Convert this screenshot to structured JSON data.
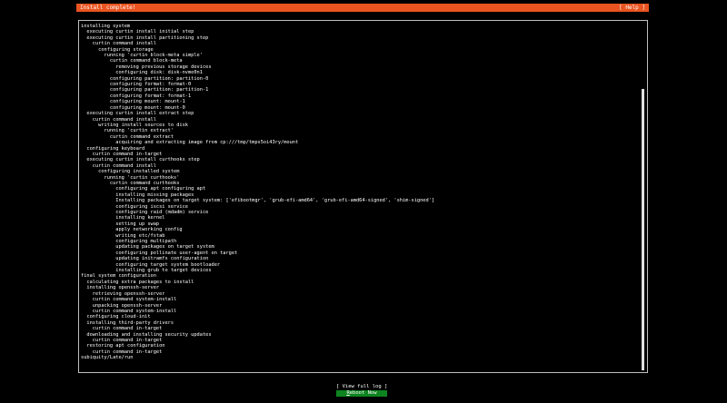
{
  "header": {
    "title": "Install complete!",
    "help": "[ Help ]"
  },
  "log": [
    "installing system",
    "  executing curtin install initial step",
    "  executing curtin install partitioning step",
    "    curtin command install",
    "      configuring storage",
    "        running 'curtin block-meta simple'",
    "          curtin command block-meta",
    "            removing previous storage devices",
    "            configuring disk: disk-nvme0n1",
    "          configuring partition: partition-0",
    "          configuring format: format-0",
    "          configuring partition: partition-1",
    "          configuring format: format-1",
    "          configuring mount: mount-1",
    "          configuring mount: mount-0",
    "  executing curtin install extract step",
    "    curtin command install",
    "      writing install sources to disk",
    "        running 'curtin extract'",
    "          curtin command extract",
    "            acquiring and extracting image from cp:///tmp/tmps5oi43ry/mount",
    "  configuring keyboard",
    "    curtin command in-target",
    "  executing curtin install curthooks step",
    "    curtin command install",
    "      configuring installed system",
    "        running 'curtin curthooks'",
    "          curtin command curthooks",
    "            configuring apt configuring apt",
    "            installing missing packages",
    "            Installing packages on target system: ['efibootmgr', 'grub-efi-amd64', 'grub-efi-amd64-signed', 'shim-signed']",
    "            configuring iscsi service",
    "            configuring raid (mdadm) service",
    "            installing kernel",
    "            setting up swap",
    "            apply networking config",
    "            writing etc/fstab",
    "            configuring multipath",
    "            updating packages on target system",
    "            configuring pollinate user-agent on target",
    "            updating initramfs configuration",
    "            configuring target system bootloader",
    "            installing grub to target devices",
    "final system configuration",
    "  calculating extra packages to install",
    "  installing openssh-server",
    "    retrieving openssh-server",
    "    curtin command system-install",
    "    unpacking openssh-server",
    "    curtin command system-install",
    "  configuring cloud-init",
    "  installing third-party drivers",
    "    curtin command in-target",
    "  downloading and installing security updates",
    "    curtin command in-target",
    "  restoring apt configuration",
    "    curtin command in-target",
    "subiquity/Late/run"
  ],
  "buttons": {
    "view_log": "[ View full log ]",
    "reboot_first": "R",
    "reboot_rest": "eboot Now"
  },
  "colors": {
    "header_bg": "#e95420",
    "reboot_bg": "#0e8420",
    "background": "#000000",
    "text": "#ffffff"
  }
}
